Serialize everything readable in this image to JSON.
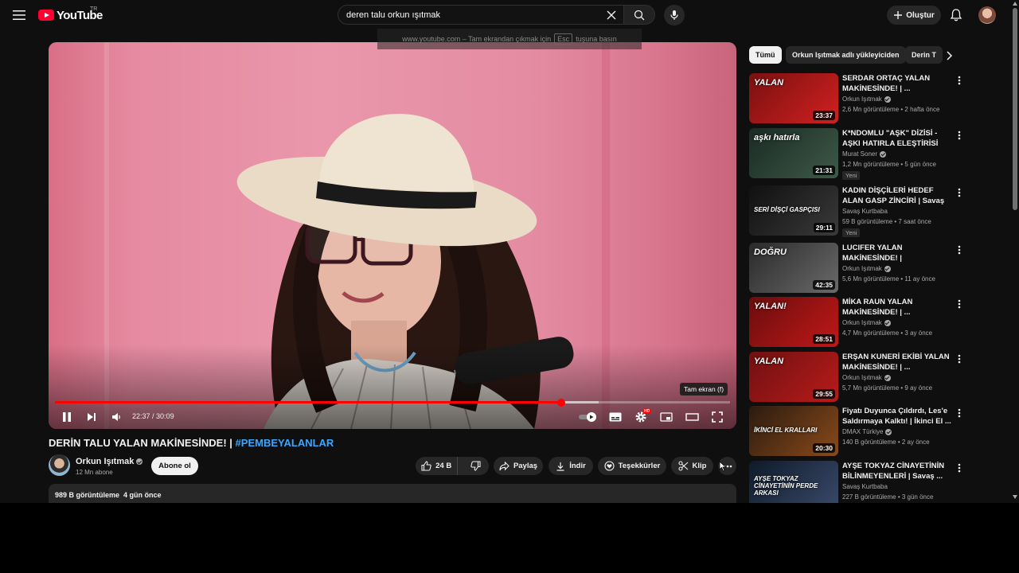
{
  "header": {
    "logo_text": "YouTube",
    "country_code": "TR",
    "search_query": "deren talu orkun ışıtmak",
    "create_label": "Oluştur"
  },
  "fullscreen_notice": {
    "prefix": "www.youtube.com – Tam ekrandan çıkmak için",
    "key": "Esc",
    "suffix": "tuşuna basın"
  },
  "player": {
    "tooltip": "Tam ekran (f)",
    "time_current": "22:37",
    "time_separator": " / ",
    "time_total": "30:09",
    "played_fraction": 0.75,
    "buffered_fraction": 0.806,
    "hd_badge": "HD"
  },
  "video": {
    "title": "DERİN TALU YALAN MAKİNESİNDE! |",
    "hashtag": "#PEMBEYALANLAR",
    "channel_name": "Orkun Işıtmak",
    "subscribers": "12 Mn abone",
    "subscribe_label": "Abone ol",
    "like_count": "24 B",
    "share_label": "Paylaş",
    "download_label": "İndir",
    "thanks_label": "Teşekkürler",
    "clip_label": "Klip",
    "views": "989 B görüntüleme",
    "uploaded": "4 gün önce"
  },
  "chips": [
    "Tümü",
    "Orkun Işıtmak adlı yükleyiciden",
    "Derin T"
  ],
  "recommendations": [
    {
      "title": "SERDAR ORTAÇ YALAN MAKİNESİNDE! | ...",
      "channel": "Orkun Işıtmak",
      "verified": true,
      "meta": "2,6 Mn görüntüleme • 2 hafta önce",
      "duration": "23:37",
      "badge": "",
      "thumb_text": "YALAN",
      "bg1": "#7a1010",
      "bg2": "#d22020"
    },
    {
      "title": "K*NDOMLU \"AŞK\" DİZİSİ - AŞKI HATIRLA ELEŞTİRİSİ",
      "channel": "Murat Soner",
      "verified": true,
      "meta": "1,2 Mn görüntüleme • 5 gün önce",
      "duration": "21:31",
      "badge": "Yeni",
      "thumb_text": "aşkı hatırla",
      "bg1": "#1b2a24",
      "bg2": "#3d5a48"
    },
    {
      "title": "KADIN DİŞÇİLERİ HEDEF ALAN GASP ZİNCİRİ | Savaş Kurtbab...",
      "channel": "Savaş Kurtbaba",
      "verified": false,
      "meta": "59 B görüntüleme • 7 saat önce",
      "duration": "29:11",
      "badge": "Yeni",
      "thumb_text": "SERİ DİŞÇİ GASPÇISI",
      "bg1": "#101010",
      "bg2": "#3a3a3a"
    },
    {
      "title": "LUCIFER YALAN MAKİNESİNDE! | #PembeYalanlar",
      "channel": "Orkun Işıtmak",
      "verified": true,
      "meta": "5,6 Mn görüntüleme • 11 ay önce",
      "duration": "42:35",
      "badge": "",
      "thumb_text": "DOĞRU",
      "bg1": "#2a2a2a",
      "bg2": "#6a6a6a"
    },
    {
      "title": "MİKA RAUN YALAN MAKİNESİNDE! | ...",
      "channel": "Orkun Işıtmak",
      "verified": true,
      "meta": "4,7 Mn görüntüleme • 3 ay önce",
      "duration": "28:51",
      "badge": "",
      "thumb_text": "YALAN!",
      "bg1": "#6a0d0d",
      "bg2": "#c01818"
    },
    {
      "title": "ERŞAN KUNERİ EKİBİ YALAN MAKİNESİNDE! | ...",
      "channel": "Orkun Işıtmak",
      "verified": true,
      "meta": "5,7 Mn görüntüleme • 9 ay önce",
      "duration": "29:55",
      "badge": "",
      "thumb_text": "YALAN",
      "bg1": "#701010",
      "bg2": "#b81b1b"
    },
    {
      "title": "Fiyatı Duyunca Çıldırdı, Les'e Saldırmaya Kalktı! | İkinci El ...",
      "channel": "DMAX Türkiye",
      "verified": true,
      "meta": "140 B görüntüleme • 2 ay önce",
      "duration": "20:30",
      "badge": "",
      "thumb_text": "İKİNCİ EL KRALLARI",
      "bg1": "#2b1b10",
      "bg2": "#8a4a1a"
    },
    {
      "title": "AYŞE TOKYAZ CİNAYETİNİN BİLİNMEYENLERİ | Savaş ...",
      "channel": "Savaş Kurtbaba",
      "verified": false,
      "meta": "227 B görüntüleme • 3 gün önce",
      "duration": "",
      "badge": "",
      "thumb_text": "AYŞE TOKYAZ CİNAYETİNİN PERDE ARKASI",
      "bg1": "#0f1a2a",
      "bg2": "#3a4a6a"
    }
  ],
  "colors": {
    "accent_red": "#ff0000",
    "link_blue": "#3ea6ff",
    "bg": "#0f0f0f",
    "pill": "#272727"
  }
}
